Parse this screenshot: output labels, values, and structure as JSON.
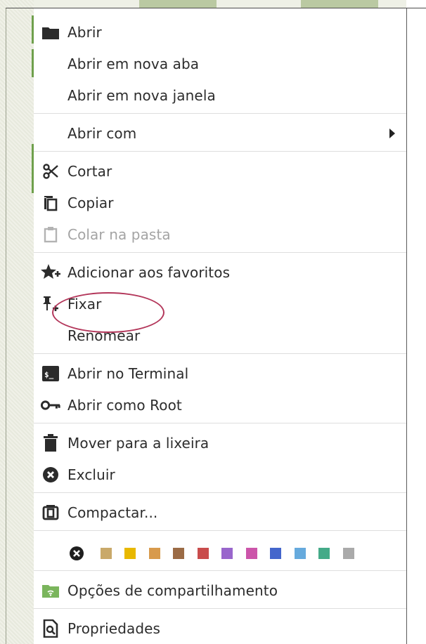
{
  "menu": {
    "items": [
      {
        "id": "abrir",
        "label": "Abrir",
        "icon": "folder-icon",
        "disabled": false
      },
      {
        "id": "abrir-aba",
        "label": "Abrir em nova aba",
        "icon": "",
        "disabled": false
      },
      {
        "id": "abrir-janela",
        "label": "Abrir em nova janela",
        "icon": "",
        "disabled": false
      },
      {
        "id": "abrir-com",
        "label": "Abrir com",
        "icon": "",
        "disabled": false,
        "submenu": true
      },
      {
        "id": "cortar",
        "label": "Cortar",
        "icon": "scissors-icon",
        "disabled": false
      },
      {
        "id": "copiar",
        "label": "Copiar",
        "icon": "copy-icon",
        "disabled": false
      },
      {
        "id": "colar",
        "label": "Colar na pasta",
        "icon": "clipboard-icon",
        "disabled": true
      },
      {
        "id": "favoritos",
        "label": "Adicionar aos favoritos",
        "icon": "star-add-icon",
        "disabled": false
      },
      {
        "id": "fixar",
        "label": "Fixar",
        "icon": "pin-add-icon",
        "disabled": false
      },
      {
        "id": "renomear",
        "label": "Renomear",
        "icon": "",
        "disabled": false
      },
      {
        "id": "terminal",
        "label": "Abrir no Terminal",
        "icon": "terminal-icon",
        "disabled": false
      },
      {
        "id": "root",
        "label": "Abrir como Root",
        "icon": "key-icon",
        "disabled": false
      },
      {
        "id": "lixeira",
        "label": "Mover para a lixeira",
        "icon": "trash-icon",
        "disabled": false
      },
      {
        "id": "excluir",
        "label": "Excluir",
        "icon": "delete-circle-icon",
        "disabled": false
      },
      {
        "id": "compactar",
        "label": "Compactar...",
        "icon": "archive-icon",
        "disabled": false
      },
      {
        "id": "compartilhamento",
        "label": "Opções de compartilhamento",
        "icon": "shared-folder-icon",
        "disabled": false
      },
      {
        "id": "propriedades",
        "label": "Propriedades",
        "icon": "properties-icon",
        "disabled": false
      }
    ]
  },
  "colors": {
    "swatches": [
      "#c9a96a",
      "#e8b800",
      "#d89a4c",
      "#9b6b45",
      "#c94c4c",
      "#9966cc",
      "#cc55aa",
      "#4466cc",
      "#66aadd",
      "#44aa88",
      "#aaaaaa"
    ],
    "highlight": "#b3365a",
    "accent_green": "#6fa04c"
  }
}
